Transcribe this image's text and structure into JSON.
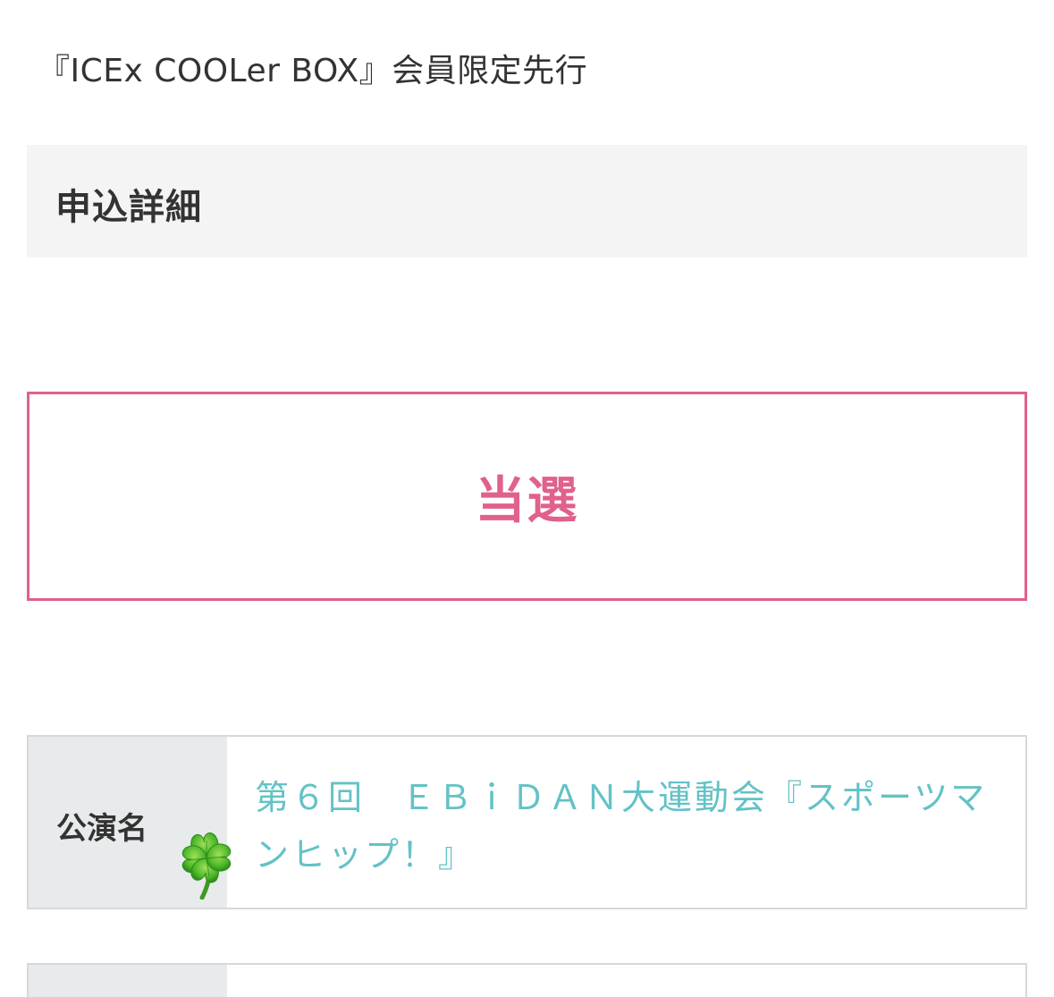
{
  "lottery": {
    "title": "『ICEx COOLer BOX』会員限定先行"
  },
  "section": {
    "header": "申込詳細"
  },
  "result": {
    "status": "当選",
    "color": "#e0618c"
  },
  "details": [
    {
      "label": "公演名",
      "value": "第６回　ＥＢｉＤＡＮ大運動会『スポーツマンヒップ！』"
    },
    {
      "label": "",
      "value": ""
    }
  ],
  "decoration": {
    "icon": "four-leaf-clover-icon"
  },
  "colors": {
    "accent": "#e0618c",
    "link": "#63c2c6",
    "label_bg": "#e7ebeb",
    "header_bg": "#f4f4f4"
  }
}
